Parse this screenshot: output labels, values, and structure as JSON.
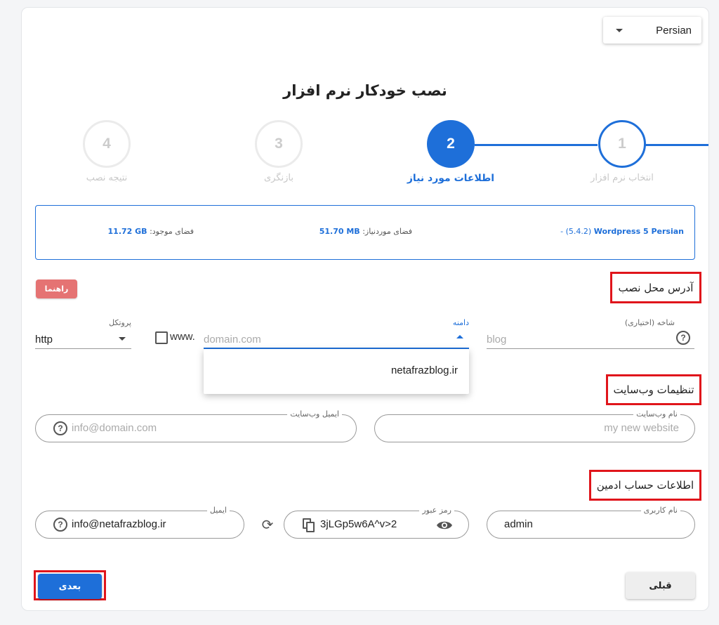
{
  "language": {
    "selected": "Persian"
  },
  "title": "نصب خودکار نرم افزار",
  "steps": [
    {
      "number": "1",
      "label": "انتخاب نرم افزار",
      "state": "done"
    },
    {
      "number": "2",
      "label": "اطلاعات مورد نیاز",
      "state": "active"
    },
    {
      "number": "3",
      "label": "بازنگری",
      "state": "todo"
    },
    {
      "number": "4",
      "label": "نتیجه نصب",
      "state": "todo"
    }
  ],
  "info": {
    "software_name": "Wordpress 5 Persian",
    "software_version": "- (5.4.2)",
    "required_label": "فضای موردنیاز:",
    "required_value": "51.70 MB",
    "available_label": "فضای موجود:",
    "available_value": "11.72 GB"
  },
  "sections": {
    "install_address": "آدرس محل نصب",
    "website_settings": "تنظیمات وب‌سایت",
    "admin_account": "اطلاعات حساب ادمین"
  },
  "guide_button": "راهنما",
  "install_fields": {
    "branch_label": "شاخه (اختیاری)",
    "branch_placeholder": "blog",
    "domain_label": "دامنه",
    "domain_placeholder": "domain.com",
    "www_label": "www.",
    "protocol_label": "پروتکل",
    "protocol_value": "http",
    "domain_options": [
      "netafrazblog.ir"
    ]
  },
  "website_fields": {
    "site_name_label": "نام وب‌سایت",
    "site_name_placeholder": "my new website",
    "site_email_label": "ایمیل وب‌سایت",
    "site_email_placeholder": "info@domain.com"
  },
  "admin_fields": {
    "username_label": "نام کاربری",
    "username_value": "admin",
    "password_label": "رمز عبور",
    "password_value": "3jLGp5w6A^v>2",
    "email_label": "ایمیل",
    "email_value": "info@netafrazblog.ir"
  },
  "buttons": {
    "next": "بعدی",
    "prev": "قبلی"
  },
  "colors": {
    "primary": "#1e6fd9",
    "highlight": "#e0151b",
    "guide": "#e57373"
  },
  "icons": [
    "chevron-down-icon",
    "chevron-up-icon",
    "help-icon",
    "refresh-icon",
    "copy-icon",
    "eye-icon"
  ]
}
